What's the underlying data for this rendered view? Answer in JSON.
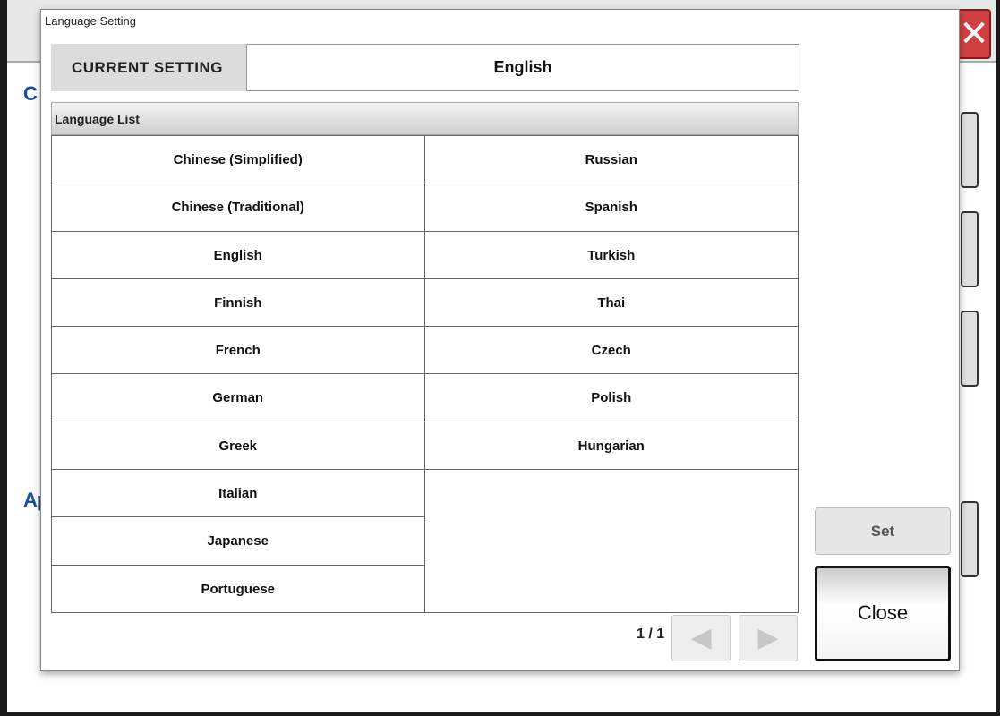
{
  "dialog": {
    "title": "Language Setting",
    "current_label": "CURRENT SETTING",
    "current_value": "English",
    "list_header": "Language List"
  },
  "languages_left": [
    "Chinese (Simplified)",
    "Chinese (Traditional)",
    "English",
    "Finnish",
    "French",
    "German",
    "Greek",
    "Italian",
    "Japanese",
    "Portuguese"
  ],
  "languages_right": [
    "Russian",
    "Spanish",
    "Turkish",
    "Thai",
    "Czech",
    "Polish",
    "Hungarian"
  ],
  "pager": {
    "text": "1 / 1",
    "prev_icon": "triangle-left-icon",
    "next_icon": "triangle-right-icon"
  },
  "buttons": {
    "set": "Set",
    "close": "Close"
  },
  "background": {
    "heading1": "C",
    "heading2": "Ap",
    "close_icon": "x-icon"
  },
  "colors": {
    "heading": "#1a4fa0",
    "app_close": "#d04040"
  }
}
